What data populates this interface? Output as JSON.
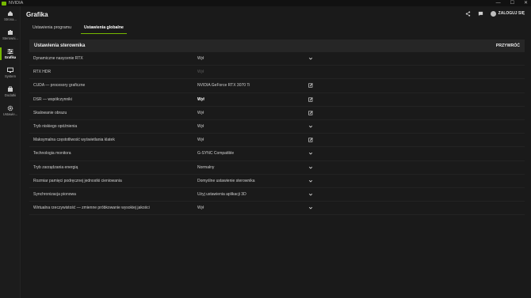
{
  "titlebar": {
    "app_title": "NVIDIA",
    "min": "—",
    "max": "☐",
    "close": "✕"
  },
  "sidebar": {
    "items": [
      {
        "label": "Strona...",
        "icon": "home-icon"
      },
      {
        "label": "Sterowni...",
        "icon": "driver-icon"
      },
      {
        "label": "Grafika",
        "icon": "sliders-icon",
        "active": true
      },
      {
        "label": "System",
        "icon": "monitor-icon"
      },
      {
        "label": "Dodatki",
        "icon": "addons-icon"
      },
      {
        "label": "Ustawie...",
        "icon": "gear-icon"
      }
    ]
  },
  "header": {
    "title": "Grafika",
    "login_label": "ZALOGUJ SIĘ"
  },
  "tabs": [
    {
      "label": "Ustawienia programu"
    },
    {
      "label": "Ustawienia globalne",
      "active": true
    }
  ],
  "panel": {
    "title": "Ustawienia sterownika",
    "reset_label": "PRZYWRÓĆ",
    "rows": [
      {
        "label": "Dynamiczne nasycenie RTX",
        "value": "Wył",
        "control": "chevron"
      },
      {
        "label": "RTX HDR",
        "value": "Wył",
        "control": "none",
        "dim": true
      },
      {
        "label": "CUDA — procesory graficzne",
        "value": "NVIDIA GeForce RTX 3070 Ti",
        "control": "edit"
      },
      {
        "label": "DSR — współczynniki",
        "value": "Wył",
        "control": "edit",
        "bold": true
      },
      {
        "label": "Skalowanie obrazu",
        "value": "Wył",
        "control": "edit"
      },
      {
        "label": "Tryb niskiego opóźnienia",
        "value": "Wył",
        "control": "chevron"
      },
      {
        "label": "Maksymalna częstotliwość wyświetlania klatek",
        "value": "Wył",
        "control": "edit"
      },
      {
        "label": "Technologia monitora",
        "value": "G-SYNC Compatible",
        "control": "chevron"
      },
      {
        "label": "Tryb zarządzania energią",
        "value": "Normalny",
        "control": "chevron"
      },
      {
        "label": "Rozmiar pamięci podręcznej jednostki cieniowania",
        "value": "Domyślne ustawienie sterownika",
        "control": "chevron"
      },
      {
        "label": "Synchronizacja pionowa",
        "value": "Użyj ustawienia aplikacji 3D",
        "control": "chevron"
      },
      {
        "label": "Wirtualna rzeczywistość — zmienne próbkowanie wysokiej jakości",
        "value": "Wył",
        "control": "chevron"
      }
    ]
  },
  "colors": {
    "accent": "#76b900",
    "background": "#1a1a1a",
    "panel_header": "#262626"
  }
}
